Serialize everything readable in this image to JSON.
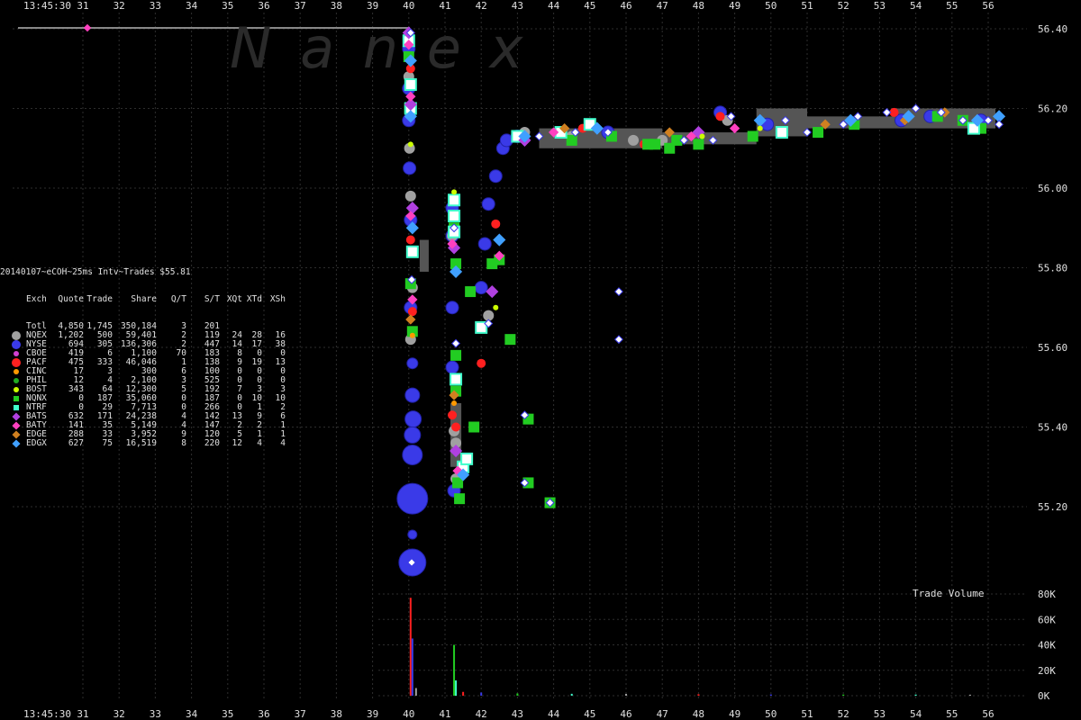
{
  "header": {
    "time_label_top": "13:45:30",
    "time_label_bottom": "13:45:30",
    "watermark": "N a n e x",
    "title": "20140107~eCOH~25ms Intv~Trades $55.81",
    "volume_label": "Trade Volume"
  },
  "colors": {
    "background": "#000000",
    "grid": "#2e2e2e",
    "text": "#e0e0e0",
    "nyse": "#3a3ae8",
    "nqex": "#a0a0a0",
    "nqnx": "#22cc22",
    "cboe": "#d040d0",
    "pacf": "#ff2020",
    "cinc": "#ff9900",
    "phil": "#22aa22",
    "bost": "#ccff00",
    "ntrf": "#40ffcc",
    "bats": "#b040e0",
    "baty": "#ff40c0",
    "edge": "#d08020",
    "edgx": "#40a0ff",
    "white": "#ffffff",
    "quote_band": "#555555"
  },
  "stats_table": {
    "headers": [
      "Exch",
      "Quote",
      "Trade",
      "Share",
      "Q/T",
      "S/T",
      "XQt",
      "XTd",
      "XSh"
    ],
    "rows": [
      {
        "exch": "Totl",
        "quote": "4,850",
        "trade": "1,745",
        "share": "350,184",
        "qt": "3",
        "st": "201",
        "xqt": "",
        "xtd": "",
        "xsh": "",
        "marker": "none",
        "color": ""
      },
      {
        "exch": "NQEX",
        "quote": "1,202",
        "trade": "500",
        "share": "59,401",
        "qt": "2",
        "st": "119",
        "xqt": "24",
        "xtd": "28",
        "xsh": "16",
        "marker": "circle-large",
        "color": "#a0a0a0"
      },
      {
        "exch": "NYSE",
        "quote": "694",
        "trade": "305",
        "share": "136,306",
        "qt": "2",
        "st": "447",
        "xqt": "14",
        "xtd": "17",
        "xsh": "38",
        "marker": "circle-large",
        "color": "#3a3ae8"
      },
      {
        "exch": "CBOE",
        "quote": "419",
        "trade": "6",
        "share": "1,100",
        "qt": "70",
        "st": "183",
        "xqt": "8",
        "xtd": "0",
        "xsh": "0",
        "marker": "circle-small",
        "color": "#d040d0"
      },
      {
        "exch": "PACF",
        "quote": "475",
        "trade": "333",
        "share": "46,046",
        "qt": "1",
        "st": "138",
        "xqt": "9",
        "xtd": "19",
        "xsh": "13",
        "marker": "circle-large",
        "color": "#ff2020"
      },
      {
        "exch": "CINC",
        "quote": "17",
        "trade": "3",
        "share": "300",
        "qt": "6",
        "st": "100",
        "xqt": "0",
        "xtd": "0",
        "xsh": "0",
        "marker": "circle-small",
        "color": "#ff9900"
      },
      {
        "exch": "PHIL",
        "quote": "12",
        "trade": "4",
        "share": "2,100",
        "qt": "3",
        "st": "525",
        "xqt": "0",
        "xtd": "0",
        "xsh": "0",
        "marker": "circle-small",
        "color": "#22aa22"
      },
      {
        "exch": "BOST",
        "quote": "343",
        "trade": "64",
        "share": "12,300",
        "qt": "5",
        "st": "192",
        "xqt": "7",
        "xtd": "3",
        "xsh": "3",
        "marker": "circle-small",
        "color": "#ccff00"
      },
      {
        "exch": "NQNX",
        "quote": "0",
        "trade": "187",
        "share": "35,060",
        "qt": "0",
        "st": "187",
        "xqt": "0",
        "xtd": "10",
        "xsh": "10",
        "marker": "square",
        "color": "#22cc22"
      },
      {
        "exch": "NTRF",
        "quote": "0",
        "trade": "29",
        "share": "7,713",
        "qt": "0",
        "st": "266",
        "xqt": "0",
        "xtd": "1",
        "xsh": "2",
        "marker": "square",
        "color": "#40ffcc"
      },
      {
        "exch": "BATS",
        "quote": "632",
        "trade": "171",
        "share": "24,238",
        "qt": "4",
        "st": "142",
        "xqt": "13",
        "xtd": "9",
        "xsh": "6",
        "marker": "diamond",
        "color": "#b040e0"
      },
      {
        "exch": "BATY",
        "quote": "141",
        "trade": "35",
        "share": "5,149",
        "qt": "4",
        "st": "147",
        "xqt": "2",
        "xtd": "2",
        "xsh": "1",
        "marker": "diamond",
        "color": "#ff40c0"
      },
      {
        "exch": "EDGE",
        "quote": "288",
        "trade": "33",
        "share": "3,952",
        "qt": "9",
        "st": "120",
        "xqt": "5",
        "xtd": "1",
        "xsh": "1",
        "marker": "diamond",
        "color": "#d08020"
      },
      {
        "exch": "EDGX",
        "quote": "627",
        "trade": "75",
        "share": "16,519",
        "qt": "8",
        "st": "220",
        "xqt": "12",
        "xtd": "4",
        "xsh": "4",
        "marker": "diamond",
        "color": "#40a0ff"
      }
    ]
  },
  "chart_data": {
    "type": "scatter",
    "x_ticks": [
      "31",
      "32",
      "33",
      "34",
      "35",
      "36",
      "37",
      "38",
      "39",
      "40",
      "41",
      "42",
      "43",
      "44",
      "45",
      "46",
      "47",
      "48",
      "49",
      "50",
      "51",
      "52",
      "53",
      "54",
      "55",
      "56"
    ],
    "x_range": [
      30,
      57
    ],
    "price_ticks": [
      "56.40",
      "56.20",
      "56.00",
      "55.80",
      "55.60",
      "55.40",
      "55.20"
    ],
    "price_range": [
      55.05,
      56.44
    ],
    "volume_ticks": [
      "80K",
      "60K",
      "40K",
      "20K",
      "0K"
    ],
    "volume_range": [
      0,
      80000
    ],
    "grid": true,
    "price_series": [
      {
        "name": "NYSE",
        "values": [
          [
            40.0,
            56.35
          ],
          [
            40.0,
            56.25
          ],
          [
            40.0,
            56.17
          ],
          [
            40.02,
            56.05
          ],
          [
            40.05,
            55.92
          ],
          [
            40.05,
            55.7
          ],
          [
            40.1,
            55.56
          ],
          [
            40.1,
            55.48
          ],
          [
            40.12,
            55.42
          ],
          [
            40.1,
            55.38
          ],
          [
            40.1,
            55.33
          ],
          [
            40.1,
            55.22
          ],
          [
            40.1,
            55.13
          ],
          [
            40.1,
            55.06
          ],
          [
            41.2,
            55.95
          ],
          [
            41.2,
            55.88
          ],
          [
            41.2,
            55.7
          ],
          [
            41.2,
            55.55
          ],
          [
            41.25,
            55.24
          ],
          [
            42.0,
            55.75
          ],
          [
            42.1,
            55.86
          ],
          [
            42.2,
            55.96
          ],
          [
            42.4,
            56.03
          ],
          [
            42.6,
            56.1
          ],
          [
            42.7,
            56.12
          ],
          [
            43.0,
            56.13
          ],
          [
            45.5,
            56.14
          ],
          [
            48.6,
            56.19
          ],
          [
            49.9,
            56.16
          ],
          [
            53.6,
            56.17
          ],
          [
            54.4,
            56.18
          ],
          [
            55.8,
            56.17
          ]
        ]
      },
      {
        "name": "NQEX",
        "values": [
          [
            40.0,
            56.38
          ],
          [
            40.0,
            56.28
          ],
          [
            40.02,
            56.1
          ],
          [
            40.05,
            55.98
          ],
          [
            40.1,
            55.75
          ],
          [
            40.05,
            55.62
          ],
          [
            41.2,
            55.88
          ],
          [
            41.25,
            55.39
          ],
          [
            41.3,
            55.36
          ],
          [
            41.3,
            55.27
          ],
          [
            42.2,
            55.68
          ],
          [
            43.2,
            56.14
          ],
          [
            44.5,
            56.13
          ],
          [
            46.2,
            56.12
          ],
          [
            47.0,
            56.12
          ],
          [
            48.8,
            56.17
          ]
        ]
      },
      {
        "name": "PACF",
        "values": [
          [
            40.05,
            56.3
          ],
          [
            40.05,
            55.87
          ],
          [
            40.1,
            55.69
          ],
          [
            41.2,
            55.43
          ],
          [
            41.3,
            55.4
          ],
          [
            42.0,
            55.56
          ],
          [
            42.4,
            55.91
          ],
          [
            43.1,
            56.13
          ],
          [
            44.8,
            56.15
          ],
          [
            46.5,
            56.11
          ],
          [
            48.6,
            56.18
          ],
          [
            53.4,
            56.19
          ]
        ]
      },
      {
        "name": "NQNX",
        "values": [
          [
            40.0,
            56.33
          ],
          [
            40.02,
            56.2
          ],
          [
            40.05,
            55.76
          ],
          [
            40.1,
            55.64
          ],
          [
            41.25,
            55.9
          ],
          [
            41.3,
            55.81
          ],
          [
            41.3,
            55.58
          ],
          [
            41.3,
            55.49
          ],
          [
            41.35,
            55.26
          ],
          [
            41.4,
            55.22
          ],
          [
            41.8,
            55.4
          ],
          [
            42.3,
            55.81
          ],
          [
            42.5,
            55.82
          ],
          [
            42.8,
            55.62
          ],
          [
            43.3,
            55.42
          ],
          [
            43.3,
            55.26
          ],
          [
            43.9,
            55.21
          ],
          [
            44.5,
            56.12
          ],
          [
            45.6,
            56.13
          ],
          [
            46.6,
            56.11
          ],
          [
            47.2,
            56.1
          ],
          [
            48.0,
            56.11
          ],
          [
            49.5,
            56.13
          ],
          [
            51.3,
            56.14
          ],
          [
            52.3,
            56.16
          ],
          [
            54.6,
            56.18
          ],
          [
            55.3,
            56.17
          ],
          [
            55.8,
            56.15
          ],
          [
            41.7,
            55.74
          ],
          [
            46.8,
            56.11
          ],
          [
            47.4,
            56.12
          ]
        ]
      },
      {
        "name": "NTRF",
        "values": [
          [
            40.0,
            56.37
          ],
          [
            40.05,
            56.26
          ],
          [
            40.05,
            56.2
          ],
          [
            40.1,
            55.84
          ],
          [
            41.25,
            55.97
          ],
          [
            41.25,
            55.93
          ],
          [
            41.25,
            55.89
          ],
          [
            41.3,
            55.52
          ],
          [
            41.5,
            55.3
          ],
          [
            41.6,
            55.32
          ],
          [
            42.0,
            55.65
          ],
          [
            43.0,
            56.13
          ],
          [
            44.2,
            56.14
          ],
          [
            45.0,
            56.16
          ],
          [
            50.3,
            56.14
          ],
          [
            55.6,
            56.15
          ]
        ]
      },
      {
        "name": "BATS",
        "values": [
          [
            40.0,
            56.39
          ],
          [
            40.05,
            56.21
          ],
          [
            40.1,
            55.95
          ],
          [
            41.25,
            55.85
          ],
          [
            41.3,
            55.34
          ],
          [
            42.3,
            55.74
          ],
          [
            43.2,
            56.12
          ],
          [
            48.0,
            56.14
          ]
        ]
      },
      {
        "name": "BATY",
        "values": [
          [
            40.0,
            56.36
          ],
          [
            40.05,
            56.23
          ],
          [
            40.05,
            55.93
          ],
          [
            40.1,
            55.72
          ],
          [
            41.2,
            55.86
          ],
          [
            41.35,
            55.29
          ],
          [
            42.5,
            55.83
          ],
          [
            44.0,
            56.14
          ],
          [
            47.8,
            56.13
          ],
          [
            49.0,
            56.15
          ]
        ]
      },
      {
        "name": "EDGE",
        "values": [
          [
            40.05,
            55.67
          ],
          [
            41.25,
            55.48
          ],
          [
            44.3,
            56.15
          ],
          [
            47.2,
            56.14
          ],
          [
            51.5,
            56.16
          ],
          [
            54.8,
            56.19
          ],
          [
            53.7,
            56.17
          ]
        ]
      },
      {
        "name": "EDGX",
        "values": [
          [
            40.05,
            56.32
          ],
          [
            40.05,
            56.18
          ],
          [
            40.1,
            55.9
          ],
          [
            41.3,
            55.79
          ],
          [
            41.5,
            55.28
          ],
          [
            42.5,
            55.87
          ],
          [
            43.2,
            56.13
          ],
          [
            45.2,
            56.15
          ],
          [
            49.7,
            56.17
          ],
          [
            52.2,
            56.17
          ],
          [
            53.8,
            56.18
          ],
          [
            55.7,
            56.17
          ],
          [
            56.3,
            56.18
          ]
        ]
      },
      {
        "name": "BOST",
        "values": [
          [
            40.05,
            56.11
          ],
          [
            41.25,
            55.99
          ],
          [
            42.4,
            55.7
          ],
          [
            44.6,
            56.14
          ],
          [
            48.1,
            56.13
          ],
          [
            49.7,
            56.15
          ]
        ]
      },
      {
        "name": "CINC",
        "values": [
          [
            40.1,
            55.63
          ],
          [
            41.25,
            55.46
          ]
        ]
      },
      {
        "name": "White",
        "values": [
          [
            40.05,
            56.39
          ],
          [
            40.08,
            55.77
          ],
          [
            40.08,
            55.06
          ],
          [
            41.25,
            55.9
          ],
          [
            41.3,
            55.61
          ],
          [
            42.2,
            55.66
          ],
          [
            43.6,
            56.13
          ],
          [
            44.6,
            56.14
          ],
          [
            45.5,
            56.14
          ],
          [
            47.6,
            56.12
          ],
          [
            48.4,
            56.12
          ],
          [
            48.9,
            56.18
          ],
          [
            50.4,
            56.17
          ],
          [
            51.0,
            56.14
          ],
          [
            52.0,
            56.16
          ],
          [
            52.4,
            56.18
          ],
          [
            53.2,
            56.19
          ],
          [
            54.0,
            56.2
          ],
          [
            54.7,
            56.19
          ],
          [
            55.3,
            56.17
          ],
          [
            56.0,
            56.17
          ],
          [
            56.3,
            56.16
          ],
          [
            45.8,
            55.74
          ],
          [
            45.8,
            55.62
          ],
          [
            43.2,
            55.43
          ],
          [
            43.2,
            55.26
          ],
          [
            43.9,
            55.21
          ]
        ]
      }
    ],
    "volume_bars": [
      [
        40.05,
        77000
      ],
      [
        40.1,
        45000
      ],
      [
        41.25,
        40000
      ],
      [
        41.3,
        12000
      ],
      [
        40.2,
        6000
      ],
      [
        41.5,
        3000
      ],
      [
        42.0,
        2500
      ],
      [
        43.0,
        1800
      ],
      [
        44.5,
        1500
      ],
      [
        46.0,
        1400
      ],
      [
        48.0,
        1200
      ],
      [
        50.0,
        1000
      ],
      [
        52.0,
        900
      ],
      [
        54.0,
        900
      ],
      [
        55.5,
        800
      ]
    ]
  }
}
